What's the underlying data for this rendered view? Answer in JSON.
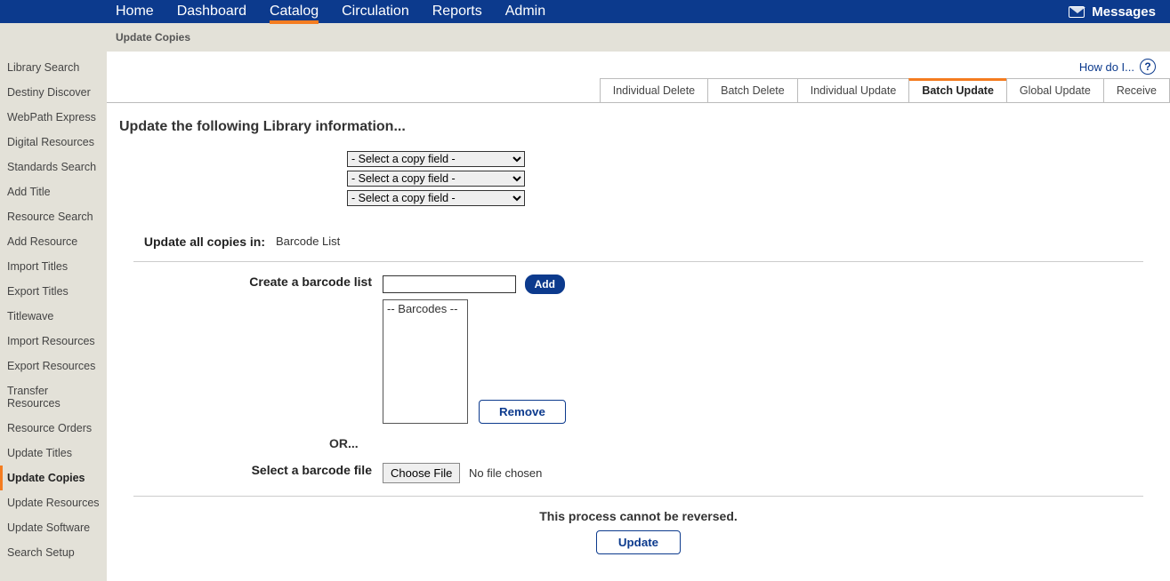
{
  "topnav": {
    "items": [
      "Home",
      "Dashboard",
      "Catalog",
      "Circulation",
      "Reports",
      "Admin"
    ],
    "active": "Catalog",
    "messages_label": "Messages"
  },
  "subhead": {
    "title": "Update Copies"
  },
  "sidebar": {
    "items": [
      "Library Search",
      "Destiny Discover",
      "WebPath Express",
      "Digital Resources",
      "Standards Search",
      "Add Title",
      "Resource Search",
      "Add Resource",
      "Import Titles",
      "Export Titles",
      "Titlewave",
      "Import Resources",
      "Export Resources",
      "Transfer Resources",
      "Resource Orders",
      "Update Titles",
      "Update Copies",
      "Update Resources",
      "Update Software",
      "Search Setup"
    ],
    "active": "Update Copies"
  },
  "help": {
    "label": "How do I...",
    "question_mark": "?"
  },
  "pagetabs": {
    "items": [
      "Individual Delete",
      "Batch Delete",
      "Individual Update",
      "Batch Update",
      "Global Update",
      "Receive"
    ],
    "active": "Batch Update"
  },
  "heading": "Update the following Library information...",
  "select_placeholder": "- Select a copy field -",
  "labels": {
    "update_all": "Update all copies in:",
    "update_all_value": "Barcode List",
    "create_barcode": "Create a barcode list",
    "select_file": "Select a barcode file",
    "or": "OR..."
  },
  "buttons": {
    "add": "Add",
    "remove": "Remove",
    "choose_file": "Choose File",
    "update": "Update"
  },
  "file": {
    "no_file": "No file chosen"
  },
  "listbox": {
    "placeholder": "-- Barcodes --"
  },
  "warning": "This process cannot be reversed."
}
